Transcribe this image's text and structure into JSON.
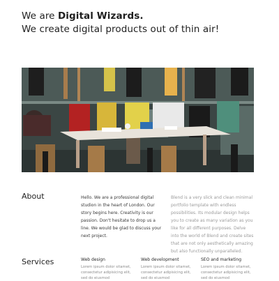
{
  "hero": {
    "line1_prefix": "We are ",
    "line1_strong": "Digital Wizards.",
    "line2": "We create digital products out of thin air!"
  },
  "about": {
    "title": "About",
    "text_primary": "Hello. We are a professional digital studion in the heart of London. Our story begins here. Creativity is our passion. Don't hesitate to drop us a line. We would be glad to discuss your next project.",
    "text_secondary": "Blend is a very slick and clean minimal portfolio template with endless possibilities. Its modular design helps you to create as many variation as you like for all different purposes. Delve into the world of Blend and create sites that are not only aesthetically amazing but also functionally unparalleled."
  },
  "services": {
    "title": "Services",
    "items": [
      {
        "name": "Web design",
        "desc": "Lorem ipsum dolor sitamet, consectetur adipisicing elit, sed do eiusmod"
      },
      {
        "name": "Web development",
        "desc": "Lorem ipsum dolor sitamet, consectetur adipisicing elit, sed do eiusmod"
      },
      {
        "name": "SEO and marketing",
        "desc": "Lorem ipsum dolor sitamet, consectetur adipisicing elit, sed do eiusmod"
      }
    ]
  },
  "colors": {
    "text": "#1f1f1f",
    "muted": "#9a9a9a",
    "background": "#ffffff"
  }
}
